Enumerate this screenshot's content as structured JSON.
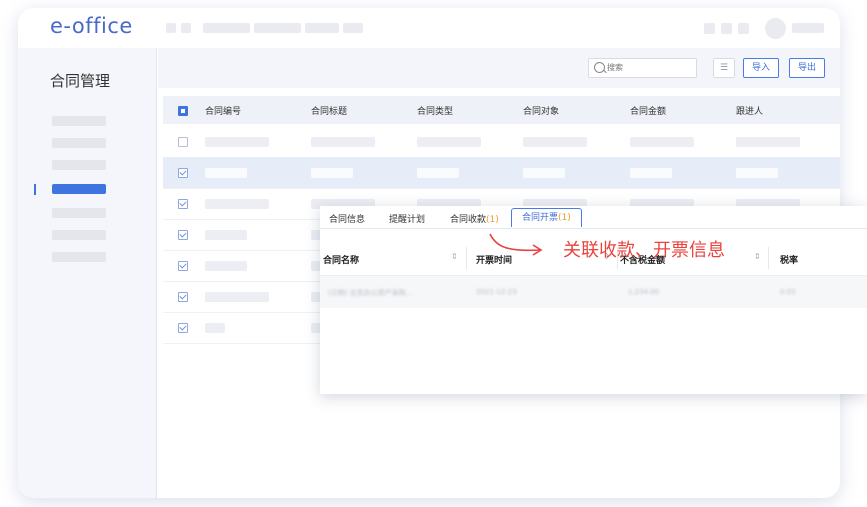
{
  "app": {
    "logo": "e-office"
  },
  "sidebar": {
    "title": "合同管理"
  },
  "toolbar": {
    "search_placeholder": "搜索",
    "import_label": "导入",
    "export_label": "导出"
  },
  "table": {
    "columns": [
      "合同编号",
      "合同标题",
      "合同类型",
      "合同对象",
      "合同金额",
      "跟进人"
    ]
  },
  "popup": {
    "tabs": [
      {
        "label": "合同信息",
        "count": ""
      },
      {
        "label": "提醒计划",
        "count": ""
      },
      {
        "label": "合同收款",
        "count": "(1)"
      },
      {
        "label": "合同开票",
        "count": "(1)"
      }
    ],
    "columns": [
      "合同名称",
      "开票时间",
      "不含税金额",
      "税率"
    ],
    "row": {
      "name": "(示例) 北京办公资产采购...",
      "date": "2021-12-23",
      "amount": "1,234.00",
      "rate": "0.03"
    }
  },
  "annotation": "关联收款、开票信息",
  "colors": {
    "accent": "#3f74e0",
    "annotation": "#e8433e",
    "count": "#f19a2a"
  }
}
